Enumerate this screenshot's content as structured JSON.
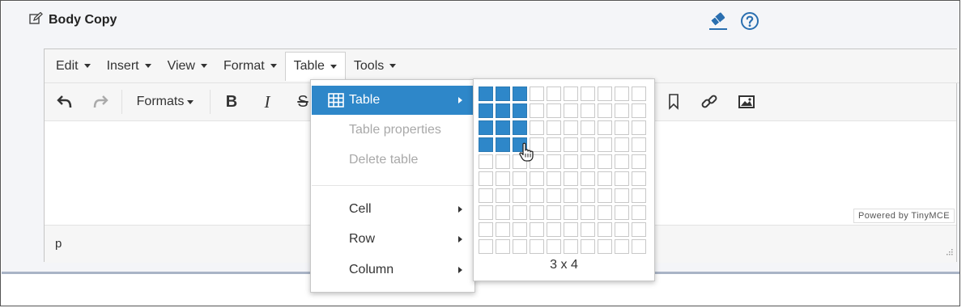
{
  "panel": {
    "title": "Body Copy",
    "title_icon": "edit-icon",
    "icons": [
      "eraser-icon",
      "help-icon"
    ]
  },
  "menubar": {
    "items": [
      {
        "label": "Edit"
      },
      {
        "label": "Insert"
      },
      {
        "label": "View"
      },
      {
        "label": "Format"
      },
      {
        "label": "Table",
        "active": true
      },
      {
        "label": "Tools"
      }
    ]
  },
  "toolbar": {
    "formats_label": "Formats",
    "buttons": [
      "undo-icon",
      "redo-icon",
      "bold-icon",
      "italic-icon",
      "strikethrough-icon",
      "bookmark-icon",
      "link-icon",
      "image-icon"
    ]
  },
  "statusbar": {
    "path": "p",
    "powered_by": "Powered by TinyMCE"
  },
  "table_menu": {
    "items": [
      {
        "label": "Table",
        "icon": "table-icon",
        "selected": true,
        "submenu": true
      },
      {
        "label": "Table properties",
        "disabled": true
      },
      {
        "label": "Delete table",
        "disabled": true
      },
      {
        "label": "Cell",
        "submenu": true
      },
      {
        "label": "Row",
        "submenu": true
      },
      {
        "label": "Column",
        "submenu": true
      }
    ]
  },
  "table_grid": {
    "rows": 10,
    "cols": 10,
    "selected_cols": 3,
    "selected_rows": 4,
    "label": "3 x 4"
  },
  "colors": {
    "accent": "#2e87c9",
    "panel_bg": "#f4f5f8",
    "link_blue": "#2a6fb0"
  }
}
